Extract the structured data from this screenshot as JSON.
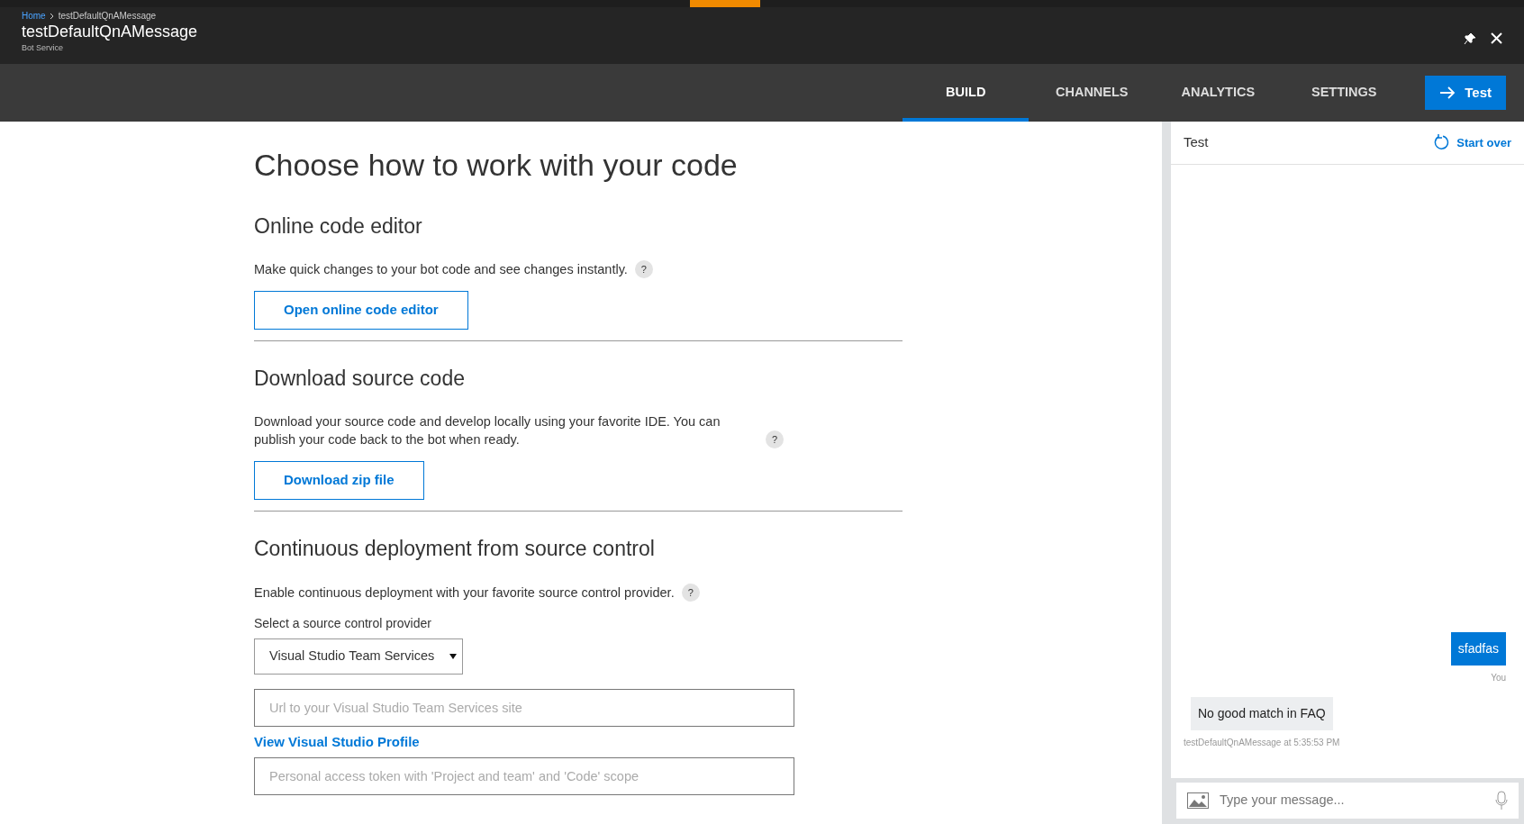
{
  "breadcrumb": [
    "Home",
    "testDefaultQnAMessage"
  ],
  "blade": {
    "title": "testDefaultQnAMessage",
    "subtitle": "Bot Service"
  },
  "tabs": [
    {
      "label": "BUILD",
      "selected": true
    },
    {
      "label": "CHANNELS",
      "selected": false
    },
    {
      "label": "ANALYTICS",
      "selected": false
    },
    {
      "label": "SETTINGS",
      "selected": false
    }
  ],
  "test_button": "Test",
  "page_title": "Choose how to work with your code",
  "sections": [
    {
      "kind": "button",
      "title": "Online code editor",
      "description": "Make quick changes to your bot code and see changes instantly.",
      "button": "Open online code editor"
    },
    {
      "kind": "button",
      "title": "Download source code",
      "description": "Download your source code and develop locally using your favorite IDE. You can publish your code back to the bot when ready.",
      "button": "Download zip file"
    },
    {
      "kind": "form",
      "title": "Continuous deployment from source control",
      "description": "Enable continuous deployment with your favorite source control provider.",
      "select_label": "Select a source control provider",
      "select_value": "Visual Studio Team Services",
      "url_placeholder": "Url to your Visual Studio Team Services site",
      "link": "View Visual Studio Profile",
      "token_placeholder": "Personal access token with 'Project and team' and 'Code' scope"
    }
  ],
  "help_mark": "?",
  "chat": {
    "title": "Test",
    "start_over": "Start over",
    "messages": [
      {
        "kind": "user",
        "text": "sfadfas",
        "meta": "You"
      },
      {
        "kind": "bot",
        "text": "No good match in FAQ",
        "meta": "testDefaultQnAMessage at 5:35:53 PM"
      }
    ],
    "input_placeholder": "Type your message..."
  }
}
